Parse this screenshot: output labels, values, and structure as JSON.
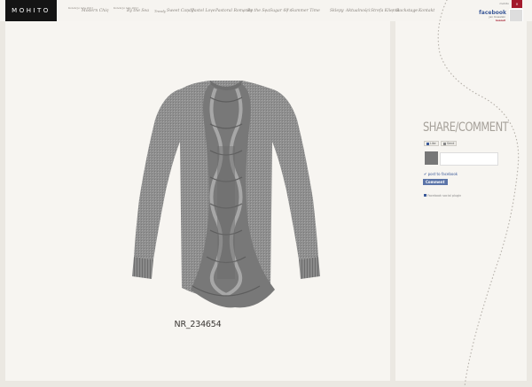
{
  "logo": "MOHITO",
  "collections": [
    {
      "small": "Kolekcja lato 2011",
      "label": "Modern Chic"
    },
    {
      "small": "Kolekcja lato 2011",
      "label": "By the Sea"
    }
  ],
  "trendy_label": "Trendy",
  "trends": [
    "Sweet Candy",
    "Pastel Love",
    "Pastoral Romance",
    "By the Sea",
    "Sugar 60's",
    "Summer Time"
  ],
  "menu": [
    "Sklepy",
    "Aktualności",
    "Strefa Klienta",
    "Backstage",
    "Kontakt"
  ],
  "facebook": {
    "small": "mohito",
    "word": "facebook",
    "user": "Jan Kowalski",
    "logout": "logout",
    "close": "×"
  },
  "product": {
    "code": "NR_234654"
  },
  "share": {
    "title": "SHARE/COMMENT",
    "like": "Like",
    "send": "Send",
    "post_to_facebook": "post to facebook",
    "comment_button": "Comment",
    "social_plugin": "Facebook social plugin"
  }
}
